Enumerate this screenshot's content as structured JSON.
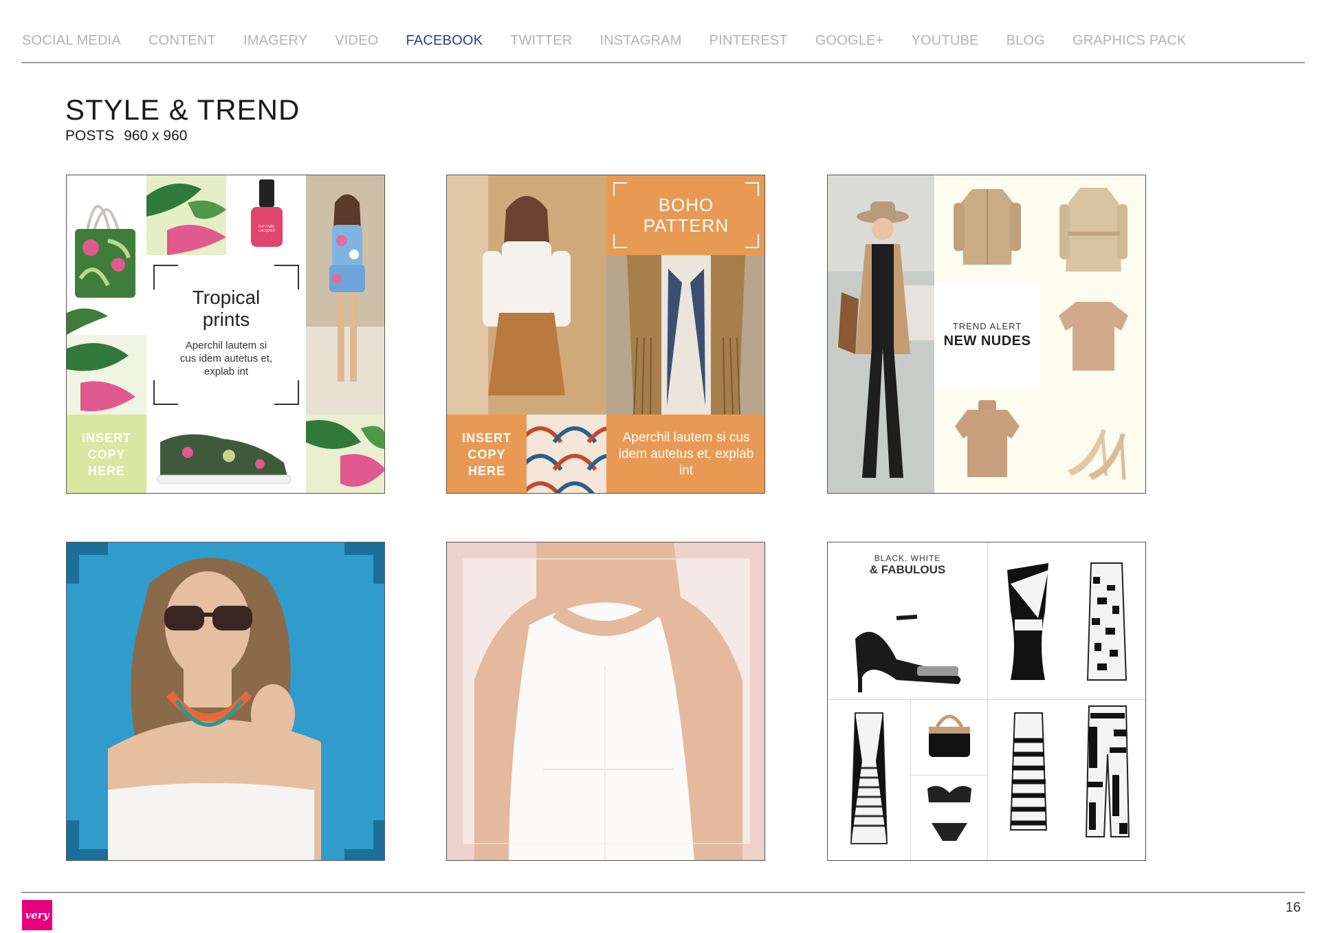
{
  "nav": {
    "items": [
      {
        "label": "SOCIAL MEDIA",
        "active": false
      },
      {
        "label": "CONTENT",
        "active": false
      },
      {
        "label": "IMAGERY",
        "active": false
      },
      {
        "label": "VIDEO",
        "active": false
      },
      {
        "label": "FACEBOOK",
        "active": true
      },
      {
        "label": "TWITTER",
        "active": false
      },
      {
        "label": "INSTAGRAM",
        "active": false
      },
      {
        "label": "PINTEREST",
        "active": false
      },
      {
        "label": "GOOGLE+",
        "active": false
      },
      {
        "label": "YOUTUBE",
        "active": false
      },
      {
        "label": "BLOG",
        "active": false
      },
      {
        "label": "GRAPHICS PACK",
        "active": false
      }
    ]
  },
  "header": {
    "title": "STYLE & TREND",
    "subtitle_label": "POSTS",
    "subtitle_size": "960 x 960"
  },
  "tiles": {
    "tropical": {
      "headline_1": "Tropical",
      "headline_2": "prints",
      "body": "Aperchil lautem si cus idem autetus et, explab int",
      "cta_1": "INSERT",
      "cta_2": "COPY",
      "cta_3": "HERE",
      "polish_label": "O·P·I NAIL LACQUER"
    },
    "boho": {
      "headline_1": "BOHO",
      "headline_2": "PATTERN",
      "cta_1": "INSERT",
      "cta_2": "COPY",
      "cta_3": "HERE",
      "body": "Aperchil lautem si cus idem autetus et, explab int"
    },
    "nudes": {
      "kicker": "TREND ALERT",
      "headline": "NEW NUDES"
    },
    "bw": {
      "kicker": "BLACK, WHITE",
      "headline": "& FABULOUS"
    }
  },
  "footer": {
    "logo": "very",
    "page_number": "16"
  },
  "colors": {
    "nav_active": "#27407f",
    "nav_inactive": "#b3b3b3",
    "boho_orange": "#e89a55",
    "tropical_green": "#d9e7a0",
    "brand_pink": "#e6007e",
    "sky_blue": "#2e9ecf",
    "blush": "#ecd2ca"
  }
}
